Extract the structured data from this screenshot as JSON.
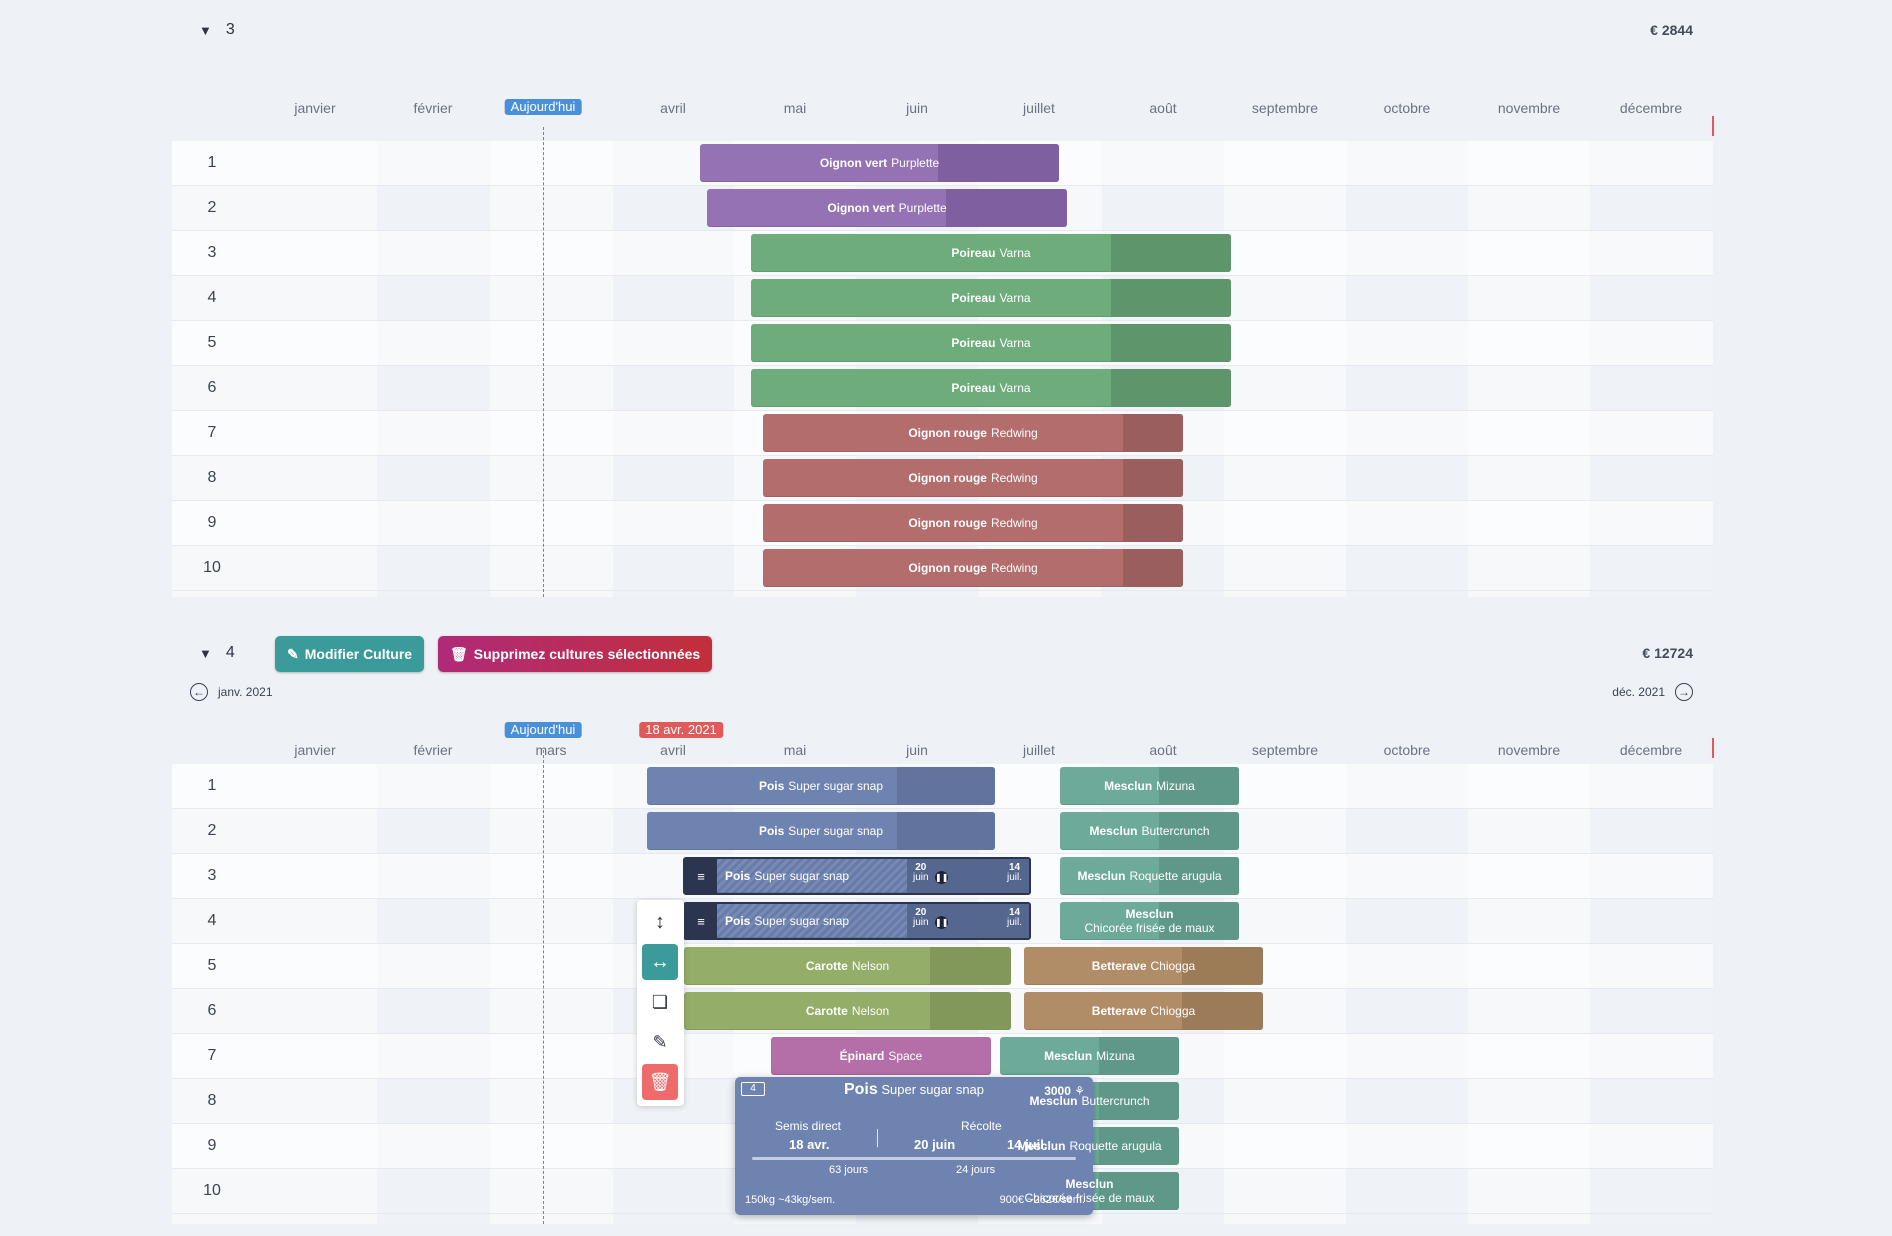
{
  "months": [
    "janvier",
    "février",
    "mars",
    "avril",
    "mai",
    "juin",
    "juillet",
    "août",
    "septembre",
    "octobre",
    "novembre",
    "décembre"
  ],
  "today_label": "Aujourd'hui",
  "section3": {
    "title": "3",
    "total": "€ 2844",
    "rows": [
      "1",
      "2",
      "3",
      "4",
      "5",
      "6",
      "7",
      "8",
      "9",
      "10"
    ],
    "crops": [
      {
        "name": "Oignon vert",
        "variety": "Purplette",
        "row": "1",
        "color": "#9572b3",
        "dark": "#7f5f9f"
      },
      {
        "name": "Oignon vert",
        "variety": "Purplette",
        "row": "2",
        "color": "#9572b3",
        "dark": "#7f5f9f"
      },
      {
        "name": "Poireau",
        "variety": "Varna",
        "row": "3",
        "color": "#6ead7b",
        "dark": "#5e956a"
      },
      {
        "name": "Poireau",
        "variety": "Varna",
        "row": "4",
        "color": "#6ead7b",
        "dark": "#5e956a"
      },
      {
        "name": "Poireau",
        "variety": "Varna",
        "row": "5",
        "color": "#6ead7b",
        "dark": "#5e956a"
      },
      {
        "name": "Poireau",
        "variety": "Varna",
        "row": "6",
        "color": "#6ead7b",
        "dark": "#5e956a"
      },
      {
        "name": "Oignon rouge",
        "variety": "Redwing",
        "row": "7",
        "color": "#b36d6d",
        "dark": "#9a5e5e"
      },
      {
        "name": "Oignon rouge",
        "variety": "Redwing",
        "row": "8",
        "color": "#b36d6d",
        "dark": "#9a5e5e"
      },
      {
        "name": "Oignon rouge",
        "variety": "Redwing",
        "row": "9",
        "color": "#b36d6d",
        "dark": "#9a5e5e"
      },
      {
        "name": "Oignon rouge",
        "variety": "Redwing",
        "row": "10",
        "color": "#b36d6d",
        "dark": "#9a5e5e"
      }
    ]
  },
  "section4": {
    "title": "4",
    "total": "€ 12724",
    "edit_button": "Modifier Culture",
    "delete_button": "Supprimez cultures sélectionnées",
    "prev_label": "janv. 2021",
    "next_label": "déc. 2021",
    "selected_date_badge": "18 avr. 2021",
    "rows": [
      "1",
      "2",
      "3",
      "4",
      "5",
      "6",
      "7",
      "8",
      "9",
      "10"
    ],
    "crops": [
      {
        "name": "Pois",
        "variety": "Super sugar snap",
        "color": "#6f83b1",
        "dark": "#62739d"
      },
      {
        "name": "Pois",
        "variety": "Super sugar snap",
        "color": "#6f83b1",
        "dark": "#62739d"
      },
      {
        "name": "Pois",
        "variety": "Super sugar snap",
        "color": "#6f83b1",
        "dark": "#55668f",
        "d1": "20",
        "m1": "juin",
        "d2": "14",
        "m2": "juil."
      },
      {
        "name": "Pois",
        "variety": "Super sugar snap",
        "color": "#6f83b1",
        "dark": "#55668f",
        "d1": "20",
        "m1": "juin",
        "d2": "14",
        "m2": "juil."
      },
      {
        "name": "Carotte",
        "variety": "Nelson",
        "color": "#94ad68",
        "dark": "#82985b"
      },
      {
        "name": "Carotte",
        "variety": "Nelson",
        "color": "#94ad68",
        "dark": "#82985b"
      },
      {
        "name": "Épinard",
        "variety": "Space",
        "color": "#b46ea8",
        "dark": "#a36098"
      },
      {
        "name": "Mesclun",
        "variety": "Mizuna",
        "color": "#6daa9a",
        "dark": "#5f9789"
      },
      {
        "name": "Mesclun",
        "variety": "Buttercrunch",
        "color": "#6daa9a",
        "dark": "#5f9789"
      },
      {
        "name": "Mesclun",
        "variety": "Roquette arugula",
        "color": "#6daa9a",
        "dark": "#5f9789"
      },
      {
        "name": "Mesclun",
        "variety": "Chicorée frisée de maux",
        "color": "#6daa9a",
        "dark": "#5f9789"
      },
      {
        "name": "Betterave",
        "variety": "Chiogga",
        "color": "#b08c67",
        "dark": "#9c7b58"
      },
      {
        "name": "Betterave",
        "variety": "Chiogga",
        "color": "#b08c67",
        "dark": "#9c7b58"
      },
      {
        "name": "Mesclun",
        "variety": "Mizuna",
        "color": "#6daa9a",
        "dark": "#5f9789"
      },
      {
        "name": "Mesclun",
        "variety": "Buttercrunch",
        "color": "#6daa9a",
        "dark": "#5f9789"
      },
      {
        "name": "Mesclun",
        "variety": "Roquette arugula",
        "color": "#6daa9a",
        "dark": "#5f9789"
      },
      {
        "name": "Mesclun",
        "variety": "Chicorée frisée de maux",
        "color": "#6daa9a",
        "dark": "#5f9789"
      }
    ],
    "popup": {
      "badge": "4",
      "title": "Pois",
      "subtitle": "Super sugar snap",
      "count": "3000",
      "sow_label": "Semis direct",
      "sow_date": "18 avr.",
      "harvest_label": "Récolte",
      "harvest_start": "20 juin",
      "harvest_end": "14 juil.",
      "days_growth": "63 jours",
      "days_harvest": "24 jours",
      "yield": "150kg ~43kg/sem.",
      "revenue": "900€ ~262€/sem."
    }
  }
}
